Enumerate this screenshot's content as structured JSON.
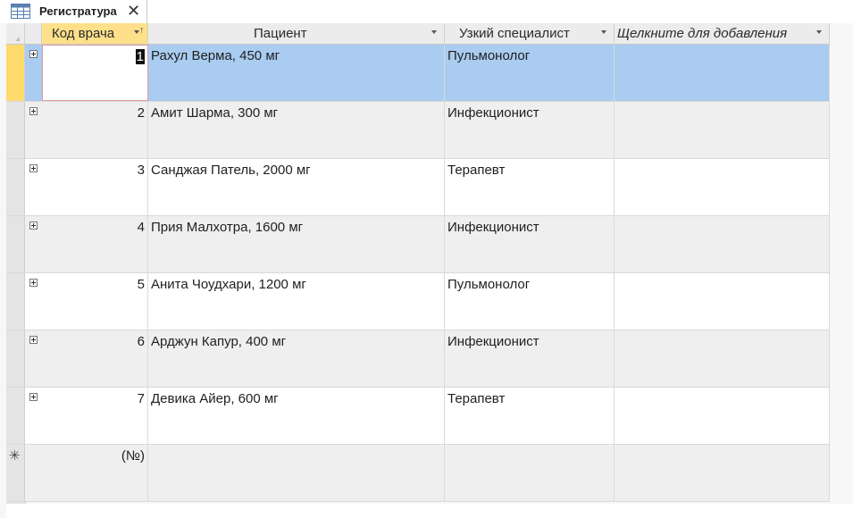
{
  "tab": {
    "title": "Регистратура",
    "close": "✕"
  },
  "columns": {
    "kod": "Код врача",
    "patient": "Пациент",
    "specialist": "Узкий специалист",
    "add": "Щелкните для добавления"
  },
  "rows": [
    {
      "id": "1",
      "patient": "Рахул Верма, 450 мг",
      "specialist": "Пульмонолог"
    },
    {
      "id": "2",
      "patient": "Амит Шарма, 300 мг",
      "specialist": "Инфекционист"
    },
    {
      "id": "3",
      "patient": "Санджая Патель, 2000 мг",
      "specialist": "Терапевт"
    },
    {
      "id": "4",
      "patient": "Прия Малхотра, 1600 мг",
      "specialist": "Инфекционист"
    },
    {
      "id": "5",
      "patient": "Анита Чоудхари, 1200 мг",
      "specialist": "Пульмонолог"
    },
    {
      "id": "6",
      "patient": "Арджун Капур, 400 мг",
      "specialist": "Инфекционист"
    },
    {
      "id": "7",
      "patient": "Девика Айер, 600 мг",
      "specialist": "Терапевт"
    }
  ],
  "new_row": {
    "marker": "✳",
    "id_placeholder": "(№)"
  }
}
